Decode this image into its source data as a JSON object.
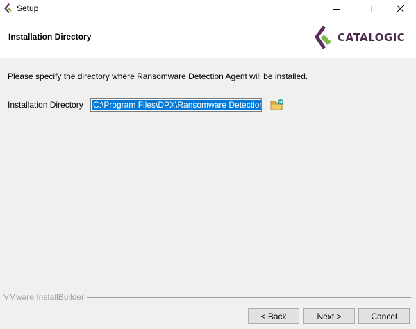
{
  "window": {
    "title": "Setup",
    "icon": "catalogic-app-icon"
  },
  "header": {
    "title": "Installation Directory",
    "logo_text": "CATALOGIC",
    "logo_colors": {
      "purple": "#5b2d5e",
      "green": "#7ab648",
      "text": "#4a2a4a"
    }
  },
  "main": {
    "instruction": "Please specify the directory where Ransomware Detection Agent will be installed.",
    "directory_label": "Installation Directory",
    "directory_value": "C:\\Program Files\\DPX\\Ransomware Detection",
    "browse_icon": "folder-browse-icon"
  },
  "footer": {
    "brand": "VMware InstallBuilder",
    "back_label": "< Back",
    "next_label": "Next >",
    "cancel_label": "Cancel"
  },
  "colors": {
    "selection": "#0078d7",
    "background": "#f0f0f0"
  }
}
